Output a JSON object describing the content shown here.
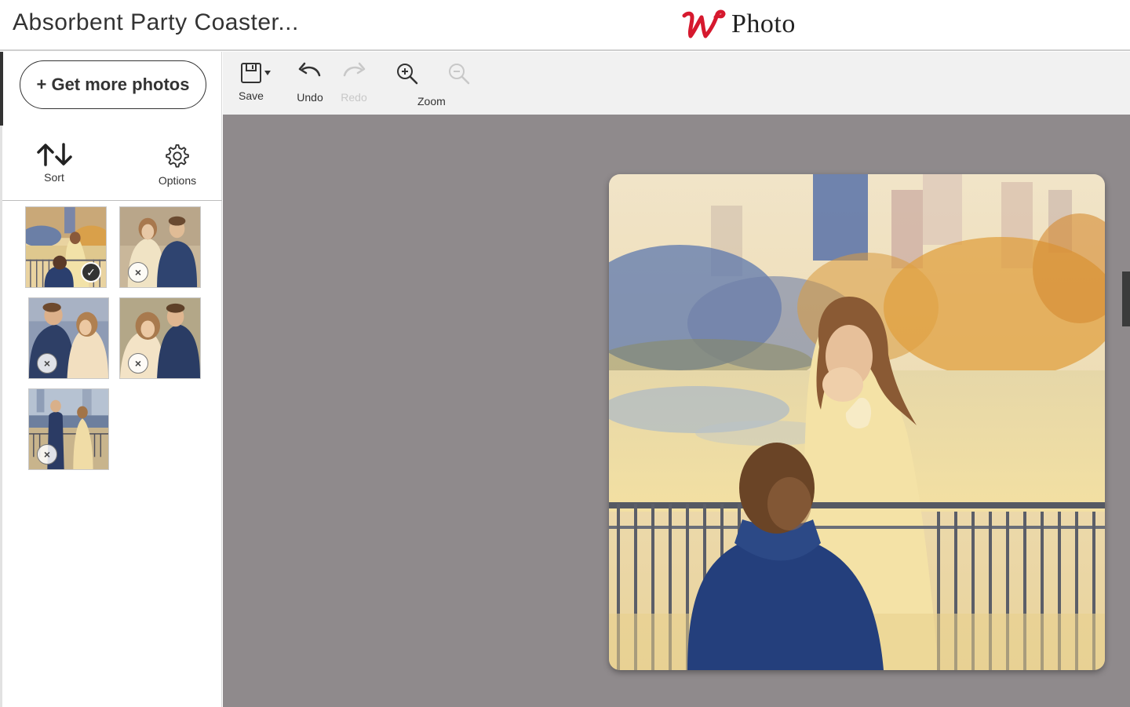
{
  "header": {
    "project_title": "Absorbent Party Coaster...",
    "brand_name": "Photo",
    "brand_logo_icon": "walgreens-w-logo",
    "brand_color": "#d6192e"
  },
  "sidebar": {
    "get_more_label": "+ Get more photos",
    "sort_label": "Sort",
    "options_label": "Options",
    "thumbnails": [
      {
        "state": "selected",
        "badge_icon": "check-icon"
      },
      {
        "state": "unused",
        "badge_icon": "close-icon"
      },
      {
        "state": "unused",
        "badge_icon": "close-icon"
      },
      {
        "state": "unused",
        "badge_icon": "close-icon"
      },
      {
        "state": "unused",
        "badge_icon": "close-icon"
      }
    ]
  },
  "toolbar": {
    "save_label": "Save",
    "undo_label": "Undo",
    "redo_label": "Redo",
    "zoom_label": "Zoom"
  },
  "colors": {
    "canvas_background": "#8f8a8c",
    "toolbar_background": "#f1f1f1"
  }
}
